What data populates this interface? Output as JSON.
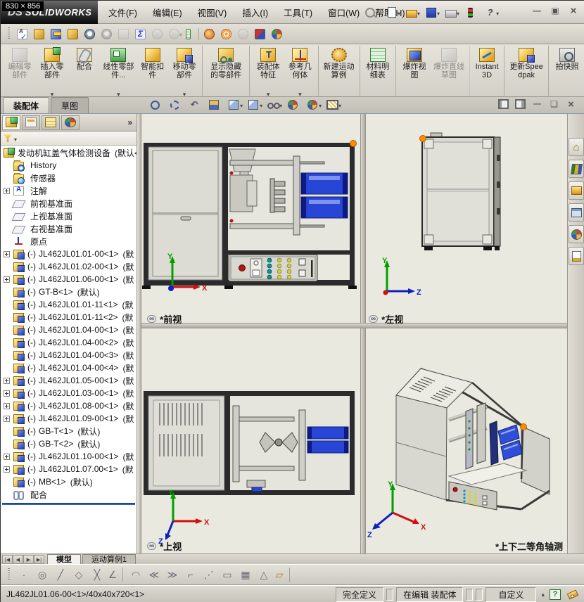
{
  "window": {
    "size_badge": "830 × 856",
    "logo_ds": "DS",
    "logo_main": "SOLIDWORKS",
    "menus": [
      {
        "label": "文件(F)"
      },
      {
        "label": "编辑(E)"
      },
      {
        "label": "视图(V)"
      },
      {
        "label": "插入(I)"
      },
      {
        "label": "工具(T)"
      },
      {
        "label": "窗口(W)"
      },
      {
        "label": "帮助(H)"
      }
    ],
    "quick_icons": [
      {
        "icon": "new-document",
        "dd": true
      },
      {
        "icon": "open",
        "dd": true
      },
      {
        "icon": "save",
        "dd": true
      },
      {
        "icon": "print",
        "dd": true
      },
      {
        "icon": "rebuild"
      },
      {
        "icon": "help",
        "dd": true
      }
    ]
  },
  "utility_toolbar": {
    "icons": [
      {
        "icon": "spell-check"
      },
      {
        "icon": "measure"
      },
      {
        "icon": "mass-properties"
      },
      {
        "icon": "section-properties"
      },
      {
        "icon": "performance-evaluation"
      },
      {
        "icon": "assembly-visualization",
        "disabled": true
      },
      {
        "icon": "check",
        "disabled": true
      },
      {
        "icon": "equations"
      },
      {
        "icon": "deviation-analysis",
        "disabled": true
      },
      {
        "icon": "compare",
        "disabled": true,
        "dd": true
      },
      {
        "icon": "design-table",
        "sep": true
      },
      {
        "icon": "preview-render"
      },
      {
        "icon": "ambient-occlusion"
      },
      {
        "icon": "verification",
        "disabled": true
      },
      {
        "icon": "edit-appearance"
      },
      {
        "icon": "photoview"
      }
    ]
  },
  "ribbon": {
    "buttons": [
      {
        "label": "编辑零部件",
        "ic": "graycube",
        "disabled": true
      },
      {
        "label": "插入零部件",
        "ic": "goldgreen",
        "dd": true
      },
      {
        "label": "配合",
        "ic": "clip"
      },
      {
        "label": "线性零部件...",
        "ic": "green",
        "dd": true
      },
      {
        "label": "智能扣件",
        "ic": "goldstar"
      },
      {
        "label": "移动零部件",
        "ic": "goldblue",
        "dd": true,
        "sep": true
      },
      {
        "label": "显示隐藏的零部件",
        "ic": "goldteal",
        "sep": true
      },
      {
        "label": "装配体特征",
        "ic": "goldT",
        "dd": true
      },
      {
        "label": "参考几何体",
        "ic": "goldaxis",
        "dd": true,
        "sep": true
      },
      {
        "label": "新建运动算例",
        "ic": "gears",
        "sep": true
      },
      {
        "label": "材料明细表",
        "ic": "table",
        "sep": true
      },
      {
        "label": "爆炸视图",
        "ic": "burst"
      },
      {
        "label": "爆炸直线草图",
        "ic": "graycube",
        "disabled": true,
        "sep": true
      },
      {
        "label": "Instant3D",
        "ic": "instant",
        "sep": true
      },
      {
        "label": "更新Speedpak",
        "ic": "goldblue2",
        "sep": true
      },
      {
        "label": "拍快照",
        "ic": "camera"
      }
    ]
  },
  "command_tabs": {
    "tabs": [
      {
        "label": "装配体",
        "active": true
      },
      {
        "label": "草图"
      }
    ]
  },
  "hud": {
    "icons": [
      {
        "icon": "zoom-fit"
      },
      {
        "icon": "zoom-area"
      },
      {
        "icon": "zoom-previous"
      },
      {
        "icon": "section-view"
      },
      {
        "icon": "view-orientation",
        "dd": true
      },
      {
        "icon": "display-style",
        "dd": true
      },
      {
        "icon": "hide-show-items",
        "dd": true
      },
      {
        "icon": "edit-appearance-ball"
      },
      {
        "icon": "apply-scene",
        "dd": true
      },
      {
        "icon": "view-settings",
        "dd": true
      }
    ]
  },
  "doc_controls": [
    {
      "icon": "tile-left"
    },
    {
      "icon": "tile-right"
    },
    {
      "icon": "minimize"
    },
    {
      "icon": "restore"
    },
    {
      "icon": "close"
    }
  ],
  "feature_panel": {
    "chevrons": "»",
    "root": {
      "label": "发动机缸盖气体检测设备",
      "suffix": "(默认<"
    },
    "items": [
      {
        "icon": "hfolder",
        "label": "History"
      },
      {
        "icon": "folder",
        "label": "传感器"
      },
      {
        "icon": "note",
        "exp": true,
        "label": "注解"
      },
      {
        "icon": "plane",
        "label": "前视基准面"
      },
      {
        "icon": "plane",
        "label": "上视基准面"
      },
      {
        "icon": "plane",
        "label": "右视基准面"
      },
      {
        "icon": "origin",
        "label": "原点"
      },
      {
        "icon": "part",
        "exp": true,
        "prefix": "(-)",
        "label": "JL462JL01.01-00<1>",
        "suffix": "(默"
      },
      {
        "icon": "part",
        "prefix": "(-)",
        "label": "JL462JL01.02-00<1>",
        "suffix": "(默"
      },
      {
        "icon": "part",
        "exp": true,
        "prefix": "(-)",
        "label": "JL462JL01.06-00<1>",
        "suffix": "(默"
      },
      {
        "icon": "part",
        "prefix": "(-)",
        "label": "GT-B<1>",
        "suffix": "(默认)"
      },
      {
        "icon": "part",
        "prefix": "(-)",
        "label": "JL462JL01.01-11<1>",
        "suffix": "(默"
      },
      {
        "icon": "part",
        "prefix": "(-)",
        "label": "JL462JL01.01-11<2>",
        "suffix": "(默"
      },
      {
        "icon": "part",
        "prefix": "(-)",
        "label": "JL462JL01.04-00<1>",
        "suffix": "(默"
      },
      {
        "icon": "part",
        "prefix": "(-)",
        "label": "JL462JL01.04-00<2>",
        "suffix": "(默"
      },
      {
        "icon": "part",
        "prefix": "(-)",
        "label": "JL462JL01.04-00<3>",
        "suffix": "(默"
      },
      {
        "icon": "part",
        "prefix": "(-)",
        "label": "JL462JL01.04-00<4>",
        "suffix": "(默"
      },
      {
        "icon": "part",
        "exp": true,
        "prefix": "(-)",
        "label": "JL462JL01.05-00<1>",
        "suffix": "(默"
      },
      {
        "icon": "part",
        "exp": true,
        "prefix": "(-)",
        "label": "JL462JL01.03-00<1>",
        "suffix": "(默"
      },
      {
        "icon": "part",
        "exp": true,
        "prefix": "(-)",
        "label": "JL462JL01.08-00<1>",
        "suffix": "(默"
      },
      {
        "icon": "part",
        "exp": true,
        "prefix": "(-)",
        "label": "JL462JL01.09-00<1>",
        "suffix": "(默"
      },
      {
        "icon": "part",
        "prefix": "(-)",
        "label": "GB-T<1>",
        "suffix": "(默认)"
      },
      {
        "icon": "part",
        "prefix": "(-)",
        "label": "GB-T<2>",
        "suffix": "(默认)"
      },
      {
        "icon": "part",
        "exp": true,
        "prefix": "(-)",
        "label": "JL462JL01.10-00<1>",
        "suffix": "(默"
      },
      {
        "icon": "part",
        "exp": true,
        "prefix": "(-)",
        "label": "JL462JL01.07.00<1>",
        "suffix": "(默"
      },
      {
        "icon": "part",
        "prefix": "(-)",
        "label": "MB<1>",
        "suffix": "(默认)"
      },
      {
        "icon": "mate",
        "label": "配合"
      }
    ]
  },
  "viewport": {
    "views": [
      {
        "label": "*前视",
        "linked": true
      },
      {
        "label": "*左视",
        "linked": true
      },
      {
        "label": "*上视",
        "linked": true
      },
      {
        "label": "*上下二等角轴测",
        "linked": false
      }
    ],
    "axis": {
      "x": "X",
      "y": "Y",
      "z": "Z"
    }
  },
  "task_pane": {
    "icons": [
      {
        "icon": "resources-home"
      },
      {
        "icon": "design-library"
      },
      {
        "icon": "file-explorer"
      },
      {
        "icon": "view-palette"
      },
      {
        "icon": "appearances"
      },
      {
        "icon": "custom-properties"
      }
    ]
  },
  "bottom": {
    "nav": [
      {
        "g": "|◀"
      },
      {
        "g": "◀"
      },
      {
        "g": "▶"
      },
      {
        "g": "▶|"
      }
    ],
    "tabs": [
      {
        "label": "模型",
        "active": true
      },
      {
        "label": "运动算例1"
      }
    ]
  },
  "sketch_toolbar": {
    "icons": [
      {
        "icon": "point",
        "g": "·"
      },
      {
        "icon": "circle",
        "g": "◎"
      },
      {
        "icon": "line",
        "g": "╱"
      },
      {
        "icon": "polygon",
        "g": "◇"
      },
      {
        "icon": "trim",
        "g": "╳"
      },
      {
        "icon": "sketch-angle",
        "g": "∠",
        "sep": true
      },
      {
        "icon": "arc",
        "g": "◠"
      },
      {
        "icon": "offset",
        "g": "≪"
      },
      {
        "icon": "mirror",
        "g": "≫"
      },
      {
        "icon": "corner",
        "g": "⌐"
      },
      {
        "icon": "spline",
        "g": "⋰"
      },
      {
        "icon": "slot",
        "g": "▭"
      },
      {
        "icon": "pattern",
        "g": "▦"
      },
      {
        "icon": "angle-dimension",
        "g": "△"
      },
      {
        "icon": "measure",
        "g": "▱",
        "gold": true,
        "sep": true
      }
    ]
  },
  "status_bar": {
    "message": "JL462JL01.06-00<1>/40x40x720<1>",
    "define_state": "完全定义",
    "edit_state": "在编辑 装配体",
    "units": "自定义",
    "help": "?"
  },
  "colors": {
    "accent_orange": "#ff8c00",
    "part_blue": "#2746d6",
    "rollback_blue": "#2f63c4",
    "viewport_bg": "#e9e9df"
  }
}
